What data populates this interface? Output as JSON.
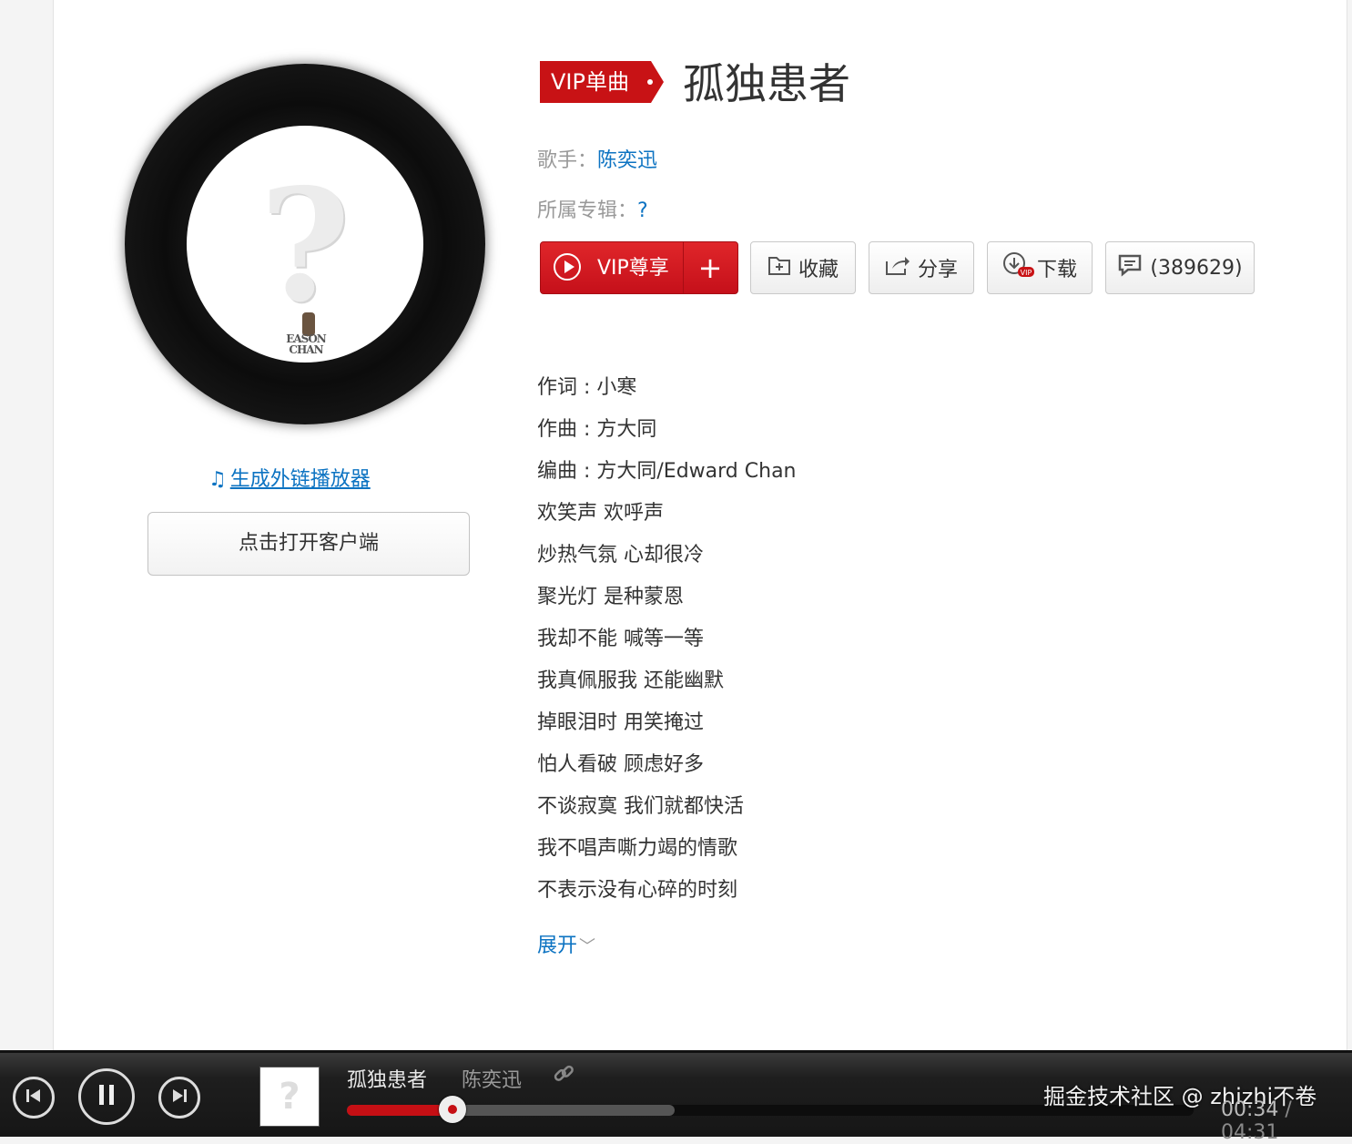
{
  "song": {
    "tag": "VIP单曲",
    "title": "孤独患者",
    "singer_label": "歌手：",
    "singer": "陈奕迅",
    "album_label": "所属专辑：",
    "album": "?"
  },
  "cover": {
    "symbol": "?",
    "text": "EASON CHAN"
  },
  "left": {
    "embed_link": "生成外链播放器",
    "open_client": "点击打开客户端"
  },
  "actions": {
    "vip": "VIP尊享",
    "plus": "+",
    "collect": "收藏",
    "share": "分享",
    "download": "下载",
    "comments": "(389629)"
  },
  "lyrics": [
    "作词 : 小寒",
    "作曲 : 方大同",
    "编曲 : 方大同/Edward Chan",
    "欢笑声 欢呼声",
    "炒热气氛 心却很冷",
    "聚光灯 是种蒙恩",
    "我却不能 喊等一等",
    "我真佩服我 还能幽默",
    "掉眼泪时 用笑掩过",
    "怕人看破 顾虑好多",
    "不谈寂寞 我们就都快活",
    "我不唱声嘶力竭的情歌",
    "不表示没有心碎的时刻"
  ],
  "expand": "展开",
  "player": {
    "title": "孤独患者",
    "artist": "陈奕迅",
    "current": "00:34",
    "total": "04:31",
    "separator": " / ",
    "progress": 0.125,
    "buffered": 0.387,
    "watermark": "掘金技术社区 @ zhizhi不卷"
  },
  "colors": {
    "accent": "#c81215",
    "link": "#0c73c2"
  }
}
